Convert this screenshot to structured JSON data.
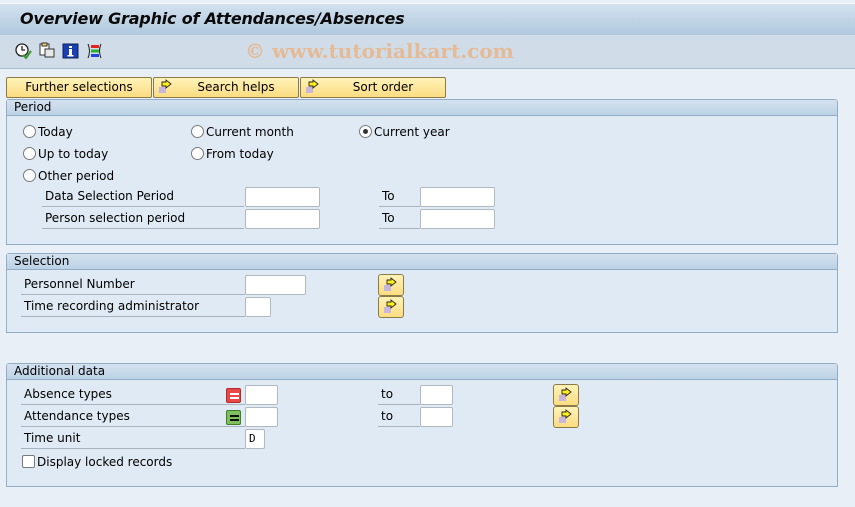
{
  "window": {
    "title": "Overview Graphic of Attendances/Absences",
    "watermark": "© www.tutorialkart.com"
  },
  "toolbar": {
    "icons": [
      {
        "name": "execute-clock-icon",
        "tooltip": ""
      },
      {
        "name": "copy-variant-icon",
        "tooltip": ""
      },
      {
        "name": "info-icon",
        "tooltip": ""
      },
      {
        "name": "color-legend-icon",
        "tooltip": ""
      }
    ]
  },
  "buttons": {
    "further_selections": "Further selections",
    "search_helps": "Search helps",
    "sort_order": "Sort order"
  },
  "period": {
    "title": "Period",
    "options": [
      {
        "label": "Today",
        "selected": false
      },
      {
        "label": "Current month",
        "selected": false
      },
      {
        "label": "Current year",
        "selected": true
      },
      {
        "label": "Up to today",
        "selected": false
      },
      {
        "label": "From today",
        "selected": false
      },
      {
        "label": "Other period",
        "selected": false
      }
    ],
    "data_selection_label": "Data Selection Period",
    "person_selection_label": "Person selection period",
    "to_label": "To",
    "data_selection_from": "",
    "data_selection_to": "",
    "person_selection_from": "",
    "person_selection_to": ""
  },
  "selection": {
    "title": "Selection",
    "personnel_number_label": "Personnel Number",
    "personnel_number_value": "",
    "time_admin_label": "Time recording administrator",
    "time_admin_value": ""
  },
  "additional": {
    "title": "Additional data",
    "absence_types_label": "Absence types",
    "absence_from": "",
    "absence_to": "",
    "attendance_types_label": "Attendance types",
    "attendance_from": "",
    "attendance_to": "",
    "to_label": "to",
    "time_unit_label": "Time unit",
    "time_unit_value": "D",
    "display_locked_label": "Display locked records",
    "display_locked_checked": false
  }
}
